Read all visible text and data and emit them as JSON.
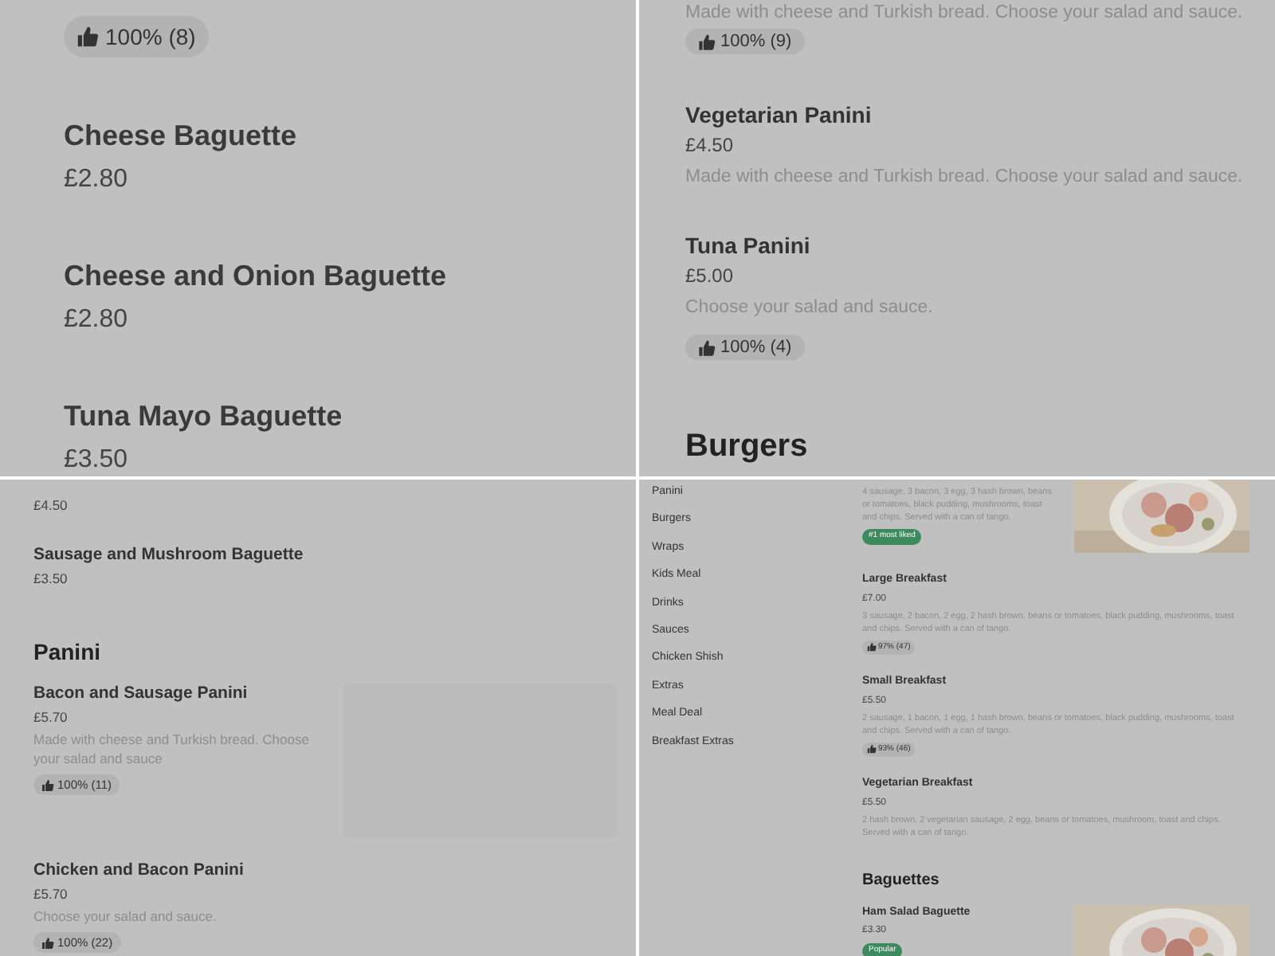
{
  "panes": [
    {
      "blocks": [
        {
          "kind": "rating",
          "text": "100% (8)"
        },
        {
          "kind": "dish",
          "name": "Cheese Baguette",
          "price": "£2.80"
        },
        {
          "kind": "dish",
          "name": "Cheese and Onion Baguette",
          "price": "£2.80"
        },
        {
          "kind": "dish",
          "name": "Tuna Mayo Baguette",
          "price": "£3.50"
        }
      ]
    },
    {
      "blocks": [
        {
          "kind": "description",
          "text": "Made with cheese and Turkish bread. Choose your salad and sauce."
        },
        {
          "kind": "rating",
          "text": "100% (9)"
        },
        {
          "kind": "dish",
          "name": "Vegetarian Panini",
          "price": "£4.50",
          "description": "Made with cheese and Turkish bread. Choose your salad and sauce."
        },
        {
          "kind": "dish",
          "name": "Tuna Panini",
          "price": "£5.00",
          "description": "Choose your salad and sauce.",
          "rating": "100% (4)"
        },
        {
          "kind": "section",
          "title": "Burgers"
        }
      ]
    },
    {
      "blocks": [
        {
          "kind": "price",
          "text": "£4.50"
        },
        {
          "kind": "dish",
          "name": "Sausage and Mushroom Baguette",
          "price": "£3.50"
        },
        {
          "kind": "section",
          "title": "Panini"
        },
        {
          "kind": "dish",
          "name": "Bacon and Sausage Panini",
          "price": "£5.70",
          "description": "Made with cheese and Turkish bread. Choose your salad and sauce",
          "rating": "100% (11)",
          "image": {
            "kind": "placeholder"
          }
        },
        {
          "kind": "dish",
          "name": "Chicken and Bacon Panini",
          "price": "£5.70",
          "description": "Choose your salad and sauce.",
          "rating": "100% (22)"
        }
      ]
    },
    {
      "sidebar": [
        "Panini",
        "Burgers",
        "Wraps",
        "Kids Meal",
        "Drinks",
        "Sauces",
        "Chicken Shish",
        "Extras",
        "Meal Deal",
        "Breakfast Extras"
      ],
      "blocks": [
        {
          "kind": "dish",
          "description": "4 sausage, 3 bacon, 3 egg, 3 hash brown, beans or tomatoes, black pudding, mushrooms, toast and chips. Served with a can of tango.",
          "badge": "#1 most liked"
        },
        {
          "kind": "dish",
          "name": "Large Breakfast",
          "price": "£7.00",
          "description": "3 sausage, 2 bacon, 2 egg, 2 hash brown, beans or tomatoes, black pudding, mushrooms, toast and chips. Served with a can of tango.",
          "rating": "97% (47)"
        },
        {
          "kind": "dish",
          "name": "Small Breakfast",
          "price": "£5.50",
          "description": "2 sausage, 1 bacon, 1 egg, 1 hash brown, beans or tomatoes, black pudding, mushrooms, toast and chips. Served with a can of tango.",
          "rating": "93% (46)"
        },
        {
          "kind": "dish",
          "name": "Vegetarian Breakfast",
          "price": "£5.50",
          "description": "2 hash brown, 2 vegetarian sausage, 2 egg, beans or tomatoes, mushroom, toast and chips. Served with a can of tango."
        },
        {
          "kind": "section",
          "title": "Baguettes"
        },
        {
          "kind": "dish",
          "name": "Ham Salad Baguette",
          "price": "£3.30",
          "badge": "Popular"
        }
      ]
    }
  ]
}
